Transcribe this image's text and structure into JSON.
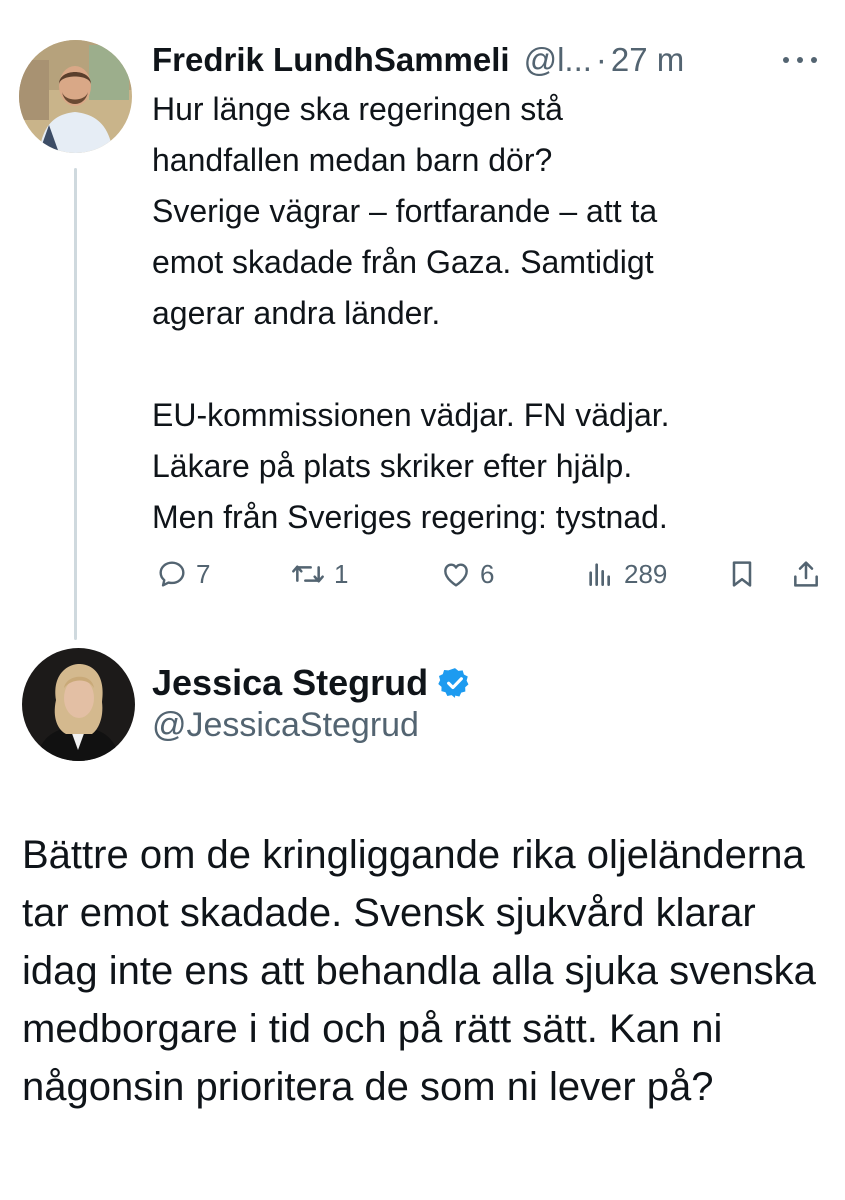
{
  "quoted_post": {
    "author_name": "Fredrik LundhSammeli",
    "author_handle": "@l...",
    "separator": "·",
    "time": "27 m",
    "text": "Hur länge ska regeringen stå\nhandfallen medan barn dör?\nSverige vägrar – fortfarande – att ta\nemot skadade från Gaza. Samtidigt\nagerar andra länder.\n\nEU-kommissionen vädjar. FN vädjar.\nLäkare på plats skriker efter hjälp.\nMen från Sveriges regering: tystnad.",
    "stats": {
      "replies": "7",
      "reposts": "1",
      "likes": "6",
      "views": "289"
    },
    "icons": [
      "more-icon",
      "reply-icon",
      "repost-icon",
      "like-icon",
      "views-icon",
      "bookmark-icon",
      "share-icon"
    ]
  },
  "reply_post": {
    "author_name": "Jessica Stegrud",
    "author_handle": "@JessicaStegrud",
    "verified": true,
    "text": "Bättre om de kringliggande rika oljeländerna tar emot skadade. Svensk sjukvård klarar idag inte ens att behandla alla sjuka svenska medborgare i tid och på rätt sätt. Kan ni någonsin prioritera de som ni lever på?"
  },
  "colors": {
    "text_primary": "#0f1419",
    "text_secondary": "#536471",
    "thread_line": "#cfd9de",
    "verified_badge": "#1d9bf0"
  }
}
